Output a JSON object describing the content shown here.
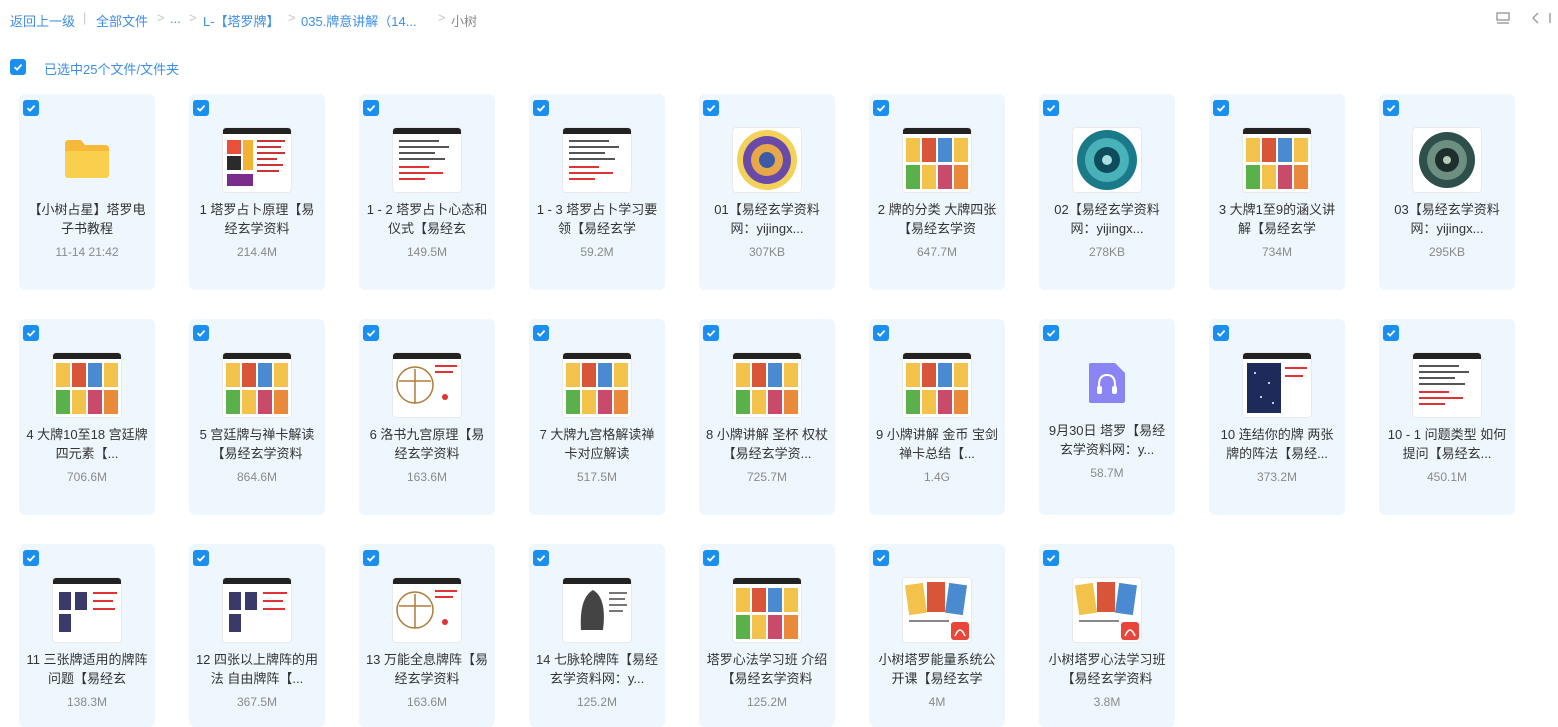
{
  "breadcrumb": {
    "back": "返回上一级",
    "all_files": "全部文件",
    "ellipsis": "...",
    "level1": "L-【塔罗牌】",
    "level2": "035.牌意讲解（14...",
    "current": "小树"
  },
  "toolbar": {
    "list_view_icon": "list-view-icon",
    "collapse_icon": "chevron-left-icon"
  },
  "selection": {
    "text": "已选中25个文件/文件夹"
  },
  "colors": {
    "accent": "#1a8ff0",
    "tile_bg": "#eef7fe",
    "link": "#3d8ee6"
  },
  "files": [
    {
      "kind": "folder",
      "name": "【小树占星】塔罗电子书教程",
      "meta": "11-14 21:42"
    },
    {
      "kind": "video",
      "name": "1 塔罗占卜原理【易经玄学资料",
      "meta": "214.4M",
      "thumb": "slide"
    },
    {
      "kind": "video",
      "name": "1 - 2 塔罗占卜心态和仪式【易经玄",
      "meta": "149.5M",
      "thumb": "doc"
    },
    {
      "kind": "video",
      "name": "1 - 3 塔罗占卜学习要领【易经玄学",
      "meta": "59.2M",
      "thumb": "doc"
    },
    {
      "kind": "image",
      "name": "01【易经玄学资料网：yijingx...",
      "meta": "307KB",
      "thumb": "mandala-gold"
    },
    {
      "kind": "video",
      "name": "2 牌的分类 大牌四张【易经玄学资",
      "meta": "647.7M",
      "thumb": "cards"
    },
    {
      "kind": "image",
      "name": "02【易经玄学资料网：yijingx...",
      "meta": "278KB",
      "thumb": "mandala-teal"
    },
    {
      "kind": "video",
      "name": "3 大牌1至9的涵义讲解【易经玄学",
      "meta": "734M",
      "thumb": "cards"
    },
    {
      "kind": "image",
      "name": "03【易经玄学资料网：yijingx...",
      "meta": "295KB",
      "thumb": "mandala-dark"
    },
    {
      "kind": "video",
      "name": "4 大牌10至18 宫廷牌 四元素【...",
      "meta": "706.6M",
      "thumb": "cards"
    },
    {
      "kind": "video",
      "name": "5 宫廷牌与禅卡解读【易经玄学资料",
      "meta": "864.6M",
      "thumb": "cards"
    },
    {
      "kind": "video",
      "name": "6 洛书九宫原理【易经玄学资料",
      "meta": "163.6M",
      "thumb": "vitruvian"
    },
    {
      "kind": "video",
      "name": "7 大牌九宫格解读禅卡对应解读",
      "meta": "517.5M",
      "thumb": "cards"
    },
    {
      "kind": "video",
      "name": "8 小牌讲解 圣杯 权杖【易经玄学资...",
      "meta": "725.7M",
      "thumb": "cards"
    },
    {
      "kind": "video",
      "name": "9 小牌讲解 金币 宝剑 禅卡总结【...",
      "meta": "1.4G",
      "thumb": "cards"
    },
    {
      "kind": "audio",
      "name": "9月30日 塔罗【易经玄学资料网：y...",
      "meta": "58.7M"
    },
    {
      "kind": "video",
      "name": "10 连结你的牌 两张牌的阵法【易经...",
      "meta": "373.2M",
      "thumb": "night"
    },
    {
      "kind": "video",
      "name": "10 - 1 问题类型 如何提问【易经玄...",
      "meta": "450.1M",
      "thumb": "doc"
    },
    {
      "kind": "video",
      "name": "11 三张牌适用的牌阵问题【易经玄",
      "meta": "138.3M",
      "thumb": "spread"
    },
    {
      "kind": "video",
      "name": "12 四张以上牌阵的用法 自由牌阵【...",
      "meta": "367.5M",
      "thumb": "spread"
    },
    {
      "kind": "video",
      "name": "13 万能全息牌阵【易经玄学资料",
      "meta": "163.6M",
      "thumb": "vitruvian"
    },
    {
      "kind": "video",
      "name": "14 七脉轮牌阵【易经玄学资料网：y...",
      "meta": "125.2M",
      "thumb": "chakra"
    },
    {
      "kind": "video",
      "name": "塔罗心法学习班 介绍【易经玄学资料",
      "meta": "125.2M",
      "thumb": "cards"
    },
    {
      "kind": "pdf",
      "name": "小树塔罗能量系统公开课【易经玄学",
      "meta": "4M",
      "thumb": "pdf"
    },
    {
      "kind": "pdf",
      "name": "小树塔罗心法学习班【易经玄学资料",
      "meta": "3.8M",
      "thumb": "pdf"
    }
  ]
}
